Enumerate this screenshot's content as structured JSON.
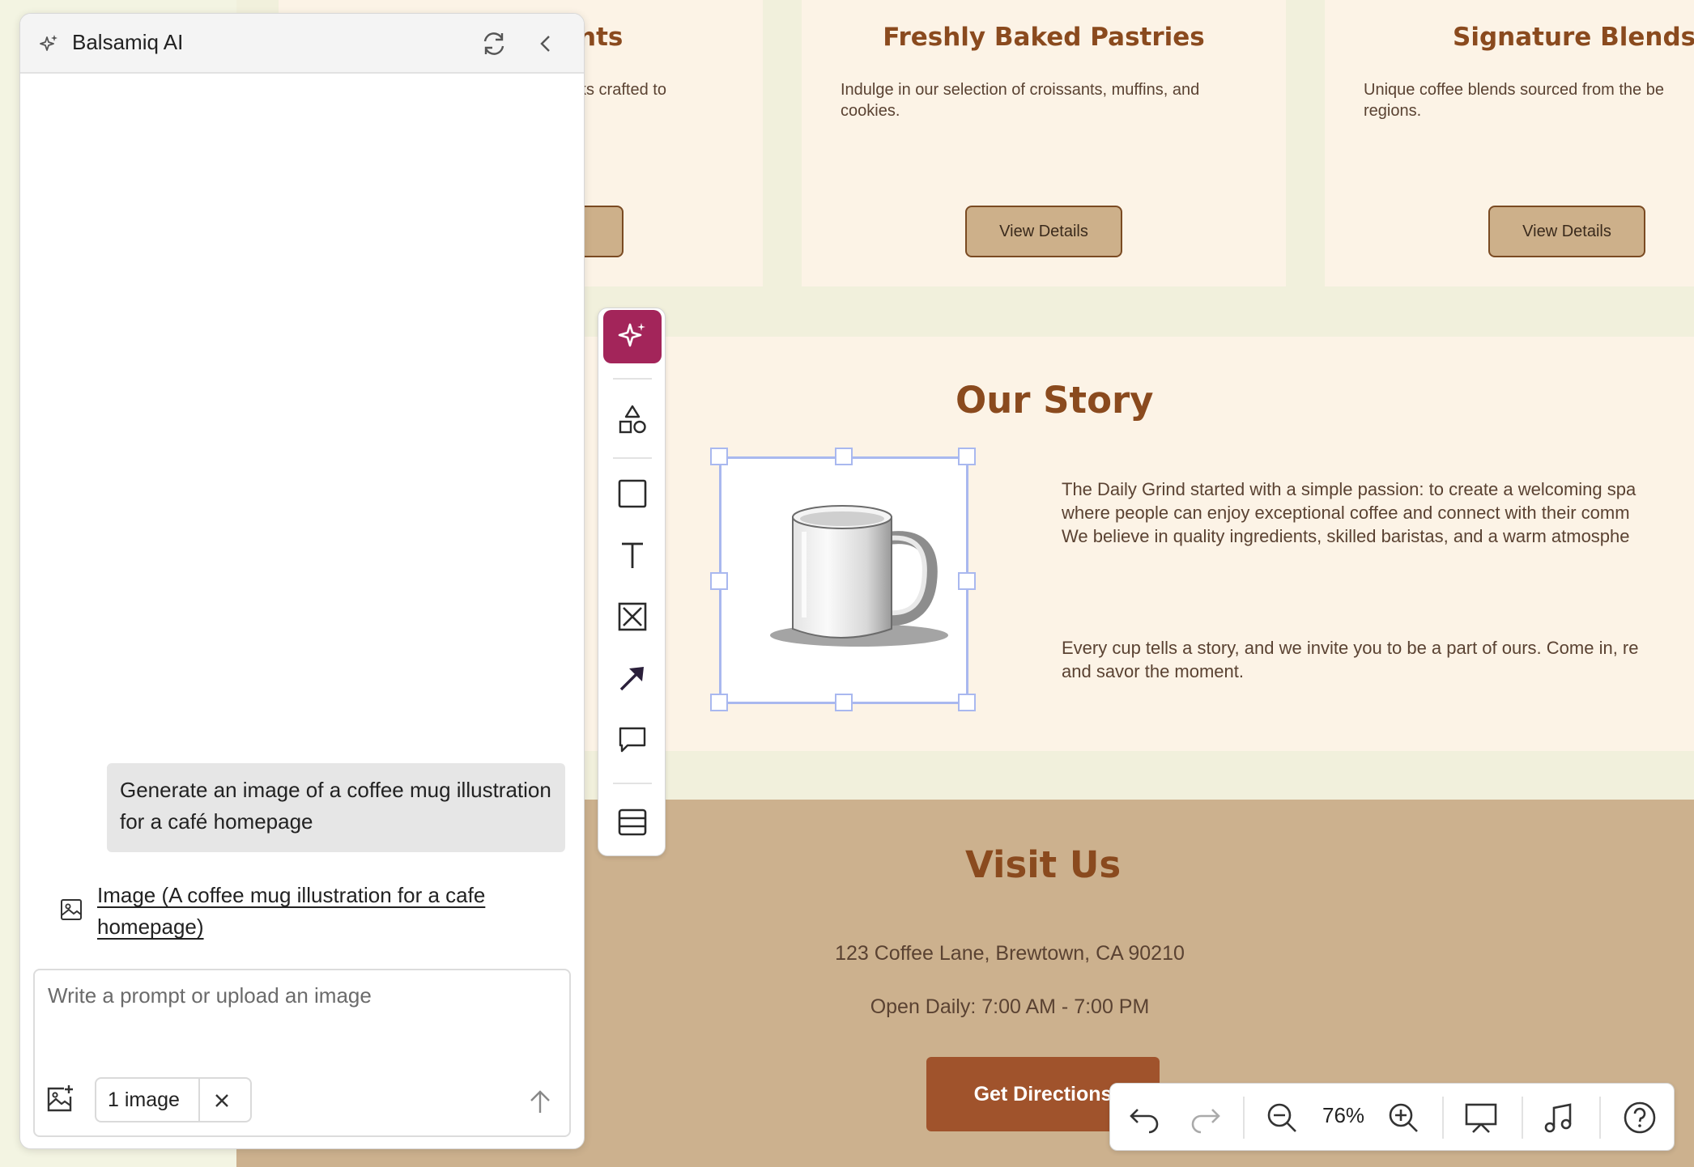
{
  "ai_panel": {
    "title": "Balsamiq AI",
    "user_message": "Generate an image of a coffee mug illustration for a café homepage",
    "result_link": "Image (A coffee mug illustration for a cafe homepage)",
    "input_placeholder": "Write a prompt or upload an image",
    "attachment_chip": "1 image"
  },
  "canvas": {
    "cards": [
      {
        "title": "hts",
        "description": "ks crafted to",
        "button": ""
      },
      {
        "title": "Freshly Baked Pastries",
        "description": "Indulge in our selection of croissants, muffins, and cookies.",
        "button": "View Details"
      },
      {
        "title": "Signature Blends",
        "description": "Unique coffee blends sourced from the be regions.",
        "button": "View Details"
      }
    ],
    "story": {
      "title": "Our Story",
      "para1_lines": [
        "The Daily Grind started with a simple passion: to create a welcoming spa",
        "where people can enjoy exceptional coffee and connect with their comm",
        "We believe in quality ingredients, skilled baristas, and a warm atmosphe"
      ],
      "para2_lines": [
        "Every cup tells a story, and we invite you to be a part of ours. Come in, re",
        "and savor the moment."
      ]
    },
    "visit": {
      "title": "Visit Us",
      "address": "123 Coffee Lane, Brewtown, CA 90210",
      "hours": "Open Daily: 7:00 AM - 7:00 PM",
      "button": "Get Directions"
    }
  },
  "bottom_bar": {
    "zoom": "76%"
  },
  "colors": {
    "accent": "#a3255a",
    "heading": "#8a4a1e",
    "card_bg": "#fcf3e6",
    "visit_bg": "#ccb18e",
    "button_bg": "#cdb08a",
    "cta_bg": "#a0532c",
    "selection": "#a9b8ef"
  },
  "icons": [
    "sparkle-icon",
    "refresh-icon",
    "chevron-left-icon",
    "shapes-icon",
    "rectangle-icon",
    "text-icon",
    "image-placeholder-icon",
    "arrow-icon",
    "comment-icon",
    "table-icon",
    "image-icon",
    "add-image-icon",
    "close-icon",
    "send-arrow-icon",
    "undo-icon",
    "redo-icon",
    "zoom-out-icon",
    "zoom-in-icon",
    "presentation-icon",
    "music-icon",
    "help-icon"
  ]
}
